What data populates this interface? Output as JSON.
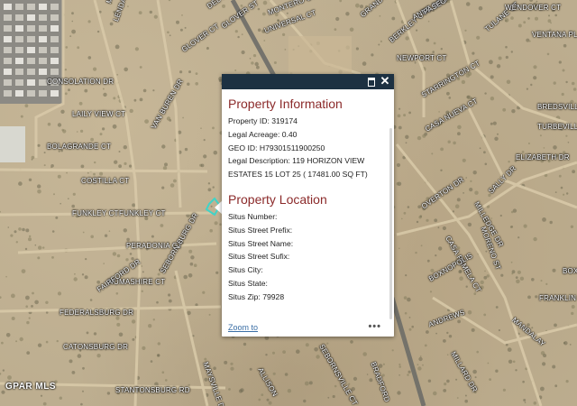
{
  "map": {
    "watermark": "GPAR MLS",
    "road_labels": [
      {
        "text": "MICHNE CT"
      },
      {
        "text": "LENDAL CT"
      },
      {
        "text": "DEL PRADO"
      },
      {
        "text": "GLOVER ST"
      },
      {
        "text": "GLOVER CT"
      },
      {
        "text": "MONTERO CT"
      },
      {
        "text": "UNIVERSAL CT"
      },
      {
        "text": "GRANDVILLE CT"
      },
      {
        "text": "BERKLEY CT"
      },
      {
        "text": "TULANE CT"
      },
      {
        "text": "WENDOVER CT"
      },
      {
        "text": "VENTANA PL"
      },
      {
        "text": "NEWPORT CT"
      },
      {
        "text": "CONSOLATION DR"
      },
      {
        "text": "LAILY VIEW CT"
      },
      {
        "text": "BOLAGRANDE CT"
      },
      {
        "text": "COSTILLA CT"
      },
      {
        "text": "FUNKLEY CT"
      },
      {
        "text": "FUNKLEY CT"
      },
      {
        "text": "PERADONIA CT"
      },
      {
        "text": "HUMASHIRE CT"
      },
      {
        "text": "FEDERALSBURG DR"
      },
      {
        "text": "CATONSBURG DR"
      },
      {
        "text": "STANTONSBURG RD"
      },
      {
        "text": "VAN BUREN DR"
      },
      {
        "text": "SEBORN BURG DR"
      },
      {
        "text": "FAIRFORD DR"
      },
      {
        "text": "MAYSVILLE DR"
      },
      {
        "text": "SEBORNSVILLE CT"
      },
      {
        "text": "STARRINGTON CT"
      },
      {
        "text": "CASA NUEVA CT"
      },
      {
        "text": "ANNE BROOK"
      },
      {
        "text": "BREDSVILLE"
      },
      {
        "text": "TURBEVILLE"
      },
      {
        "text": "ELIZABETH DR"
      },
      {
        "text": "OVERTON DR"
      },
      {
        "text": "CASA PAMELA CT"
      },
      {
        "text": "MILLEDGE DR"
      },
      {
        "text": "MORENO ST"
      },
      {
        "text": "BOXE"
      },
      {
        "text": "BOXNOPOLIS"
      },
      {
        "text": "ANDREWS"
      },
      {
        "text": "MILLARD DR"
      },
      {
        "text": "MANDALAY"
      },
      {
        "text": "BRADFORD"
      },
      {
        "text": "ALLISON"
      },
      {
        "text": "PASEO"
      },
      {
        "text": "SALLY DR"
      },
      {
        "text": "FRANKLIN DR"
      }
    ]
  },
  "popup": {
    "section1_title": "Property Information",
    "section1_rows": [
      "Property ID: 319174",
      "Legal Acreage: 0.40",
      "GEO ID: H79301511900250",
      "Legal Description: 119 HORIZON VIEW ESTATES 15 LOT 25 ( 17481.00 SQ FT)"
    ],
    "section2_title": "Property Location",
    "section2_rows": [
      "Situs Number:",
      "Situs Street Prefix:",
      "Situs Street Name:",
      "Situs Street Sufix:",
      "Situs City:",
      "Situs State:",
      "Situs Zip: 79928"
    ],
    "zoom_label": "Zoom to",
    "more_label": "•••",
    "close_label": "✕"
  },
  "colors": {
    "header": "#1d3142",
    "section_title": "#8b2a2a",
    "link": "#3a6ea5",
    "parcel_outline": "#3fd4c8"
  },
  "icons": {
    "maximize": "maximize-icon",
    "close": "close-icon",
    "more": "more-icon"
  }
}
